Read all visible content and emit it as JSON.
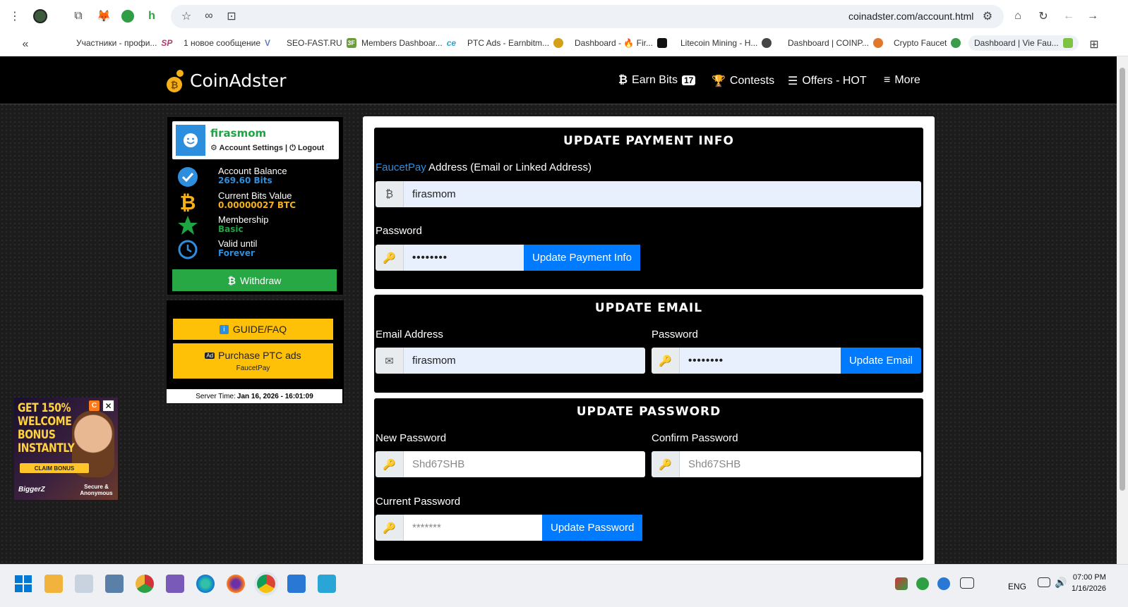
{
  "browser": {
    "url": "coinadster.com/account.html",
    "bookmarks": [
      {
        "label": "Участники - профи...",
        "icon_color": "#3b5998"
      },
      {
        "label": "1 новое сообщение",
        "icon_color": "#5f7ec2"
      },
      {
        "label": "SEO-FAST.RU",
        "icon_color": "#6b9c3a"
      },
      {
        "label": "Members Dashboar...",
        "icon_color": "#2aa6d6"
      },
      {
        "label": "PTC Ads - Earnbitm...",
        "icon_color": "#d4a017"
      },
      {
        "label": "Dashboard - 🔥 Fir...",
        "icon_color": "#111111"
      },
      {
        "label": "Litecoin Mining - H...",
        "icon_color": "#444444"
      },
      {
        "label": "Dashboard | COINP...",
        "icon_color": "#e0772b"
      },
      {
        "label": "Crypto Faucet",
        "icon_color": "#3a9d4c"
      },
      {
        "label": "Dashboard | Vie Fau...",
        "icon_color": "#7ec242"
      }
    ],
    "bookmark_sp": "SP",
    "bookmark_v": "V",
    "bookmark_3f": "3F"
  },
  "site": {
    "logo_text": "CoinAdster",
    "nav": {
      "earn_bits": "Earn Bits",
      "earn_bits_badge": "17",
      "contests": "Contests",
      "offers": "Offers - HOT",
      "more": "More"
    }
  },
  "sidebar": {
    "username": "firasmom",
    "account_settings": "Account Settings",
    "logout": "Logout",
    "stats": [
      {
        "label": "Account Balance",
        "value": "269.60 Bits",
        "color": "#2d8ede"
      },
      {
        "label": "Current Bits Value",
        "value": "0.00000027 BTC",
        "color": "#f7b118"
      },
      {
        "label": "Membership",
        "value": "Basic",
        "color": "#1fa444"
      },
      {
        "label": "Valid until",
        "value": "Forever",
        "color": "#2d8ede"
      }
    ],
    "withdraw": "Withdraw",
    "guide": "GUIDE/FAQ",
    "purchase_ptc": "Purchase PTC ads",
    "purchase_sub": "FaucetPay",
    "server_time_label": "Server Time:",
    "server_time_value": "Jan 16, 2026 - 16:01:09"
  },
  "ad": {
    "headline": "GET 150% WELCOME BONUS INSTANTLY",
    "claim": "CLAIM BONUS",
    "brand": "BiggerZ",
    "secure": "Secure & Anonymous",
    "choice": "C",
    "close": "✕"
  },
  "payment": {
    "title": "UPDATE PAYMENT INFO",
    "label_link": "FaucetPay",
    "label_rest": " Address (Email or Linked Address)",
    "address_value": "firasmom",
    "password_label": "Password",
    "password_value": "••••••••",
    "button": "Update Payment Info"
  },
  "email": {
    "title": "UPDATE EMAIL",
    "email_label": "Email Address",
    "email_value": "firasmom",
    "password_label": "Password",
    "password_value": "••••••••",
    "button": "Update Email"
  },
  "password": {
    "title": "UPDATE PASSWORD",
    "new_label": "New Password",
    "new_placeholder": "Shd67SHB",
    "confirm_label": "Confirm Password",
    "confirm_placeholder": "Shd67SHB",
    "current_label": "Current Password",
    "current_placeholder": "*******",
    "button": "Update Password"
  },
  "taskbar": {
    "lang": "ENG",
    "time": "07:00 PM",
    "date": "1/16/2026"
  }
}
